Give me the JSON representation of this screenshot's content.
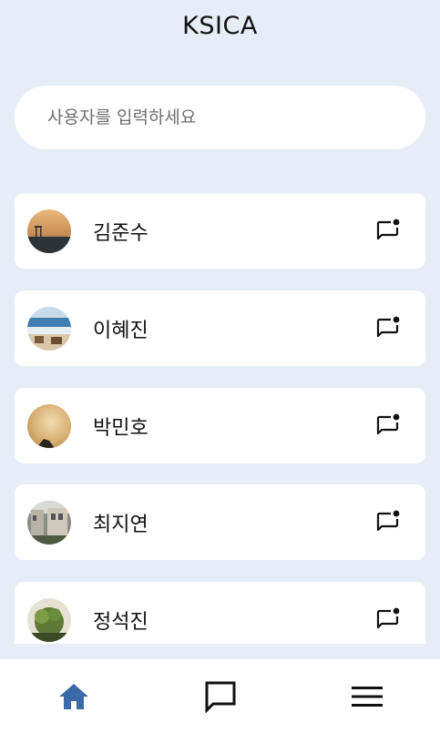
{
  "app": {
    "title": "KSICA"
  },
  "search": {
    "placeholder": "사용자를 입력하세요",
    "value": ""
  },
  "users": [
    {
      "name": "김준수"
    },
    {
      "name": "이혜진"
    },
    {
      "name": "박민호"
    },
    {
      "name": "최지연"
    },
    {
      "name": "정석진"
    }
  ],
  "nav": {
    "items": [
      {
        "icon": "home-icon",
        "active": true
      },
      {
        "icon": "chat-icon",
        "active": false
      },
      {
        "icon": "menu-icon",
        "active": false
      }
    ]
  },
  "colors": {
    "background": "#e7edf6",
    "card": "#ffffff",
    "accent": "#3b6aa8",
    "text": "#111111"
  }
}
